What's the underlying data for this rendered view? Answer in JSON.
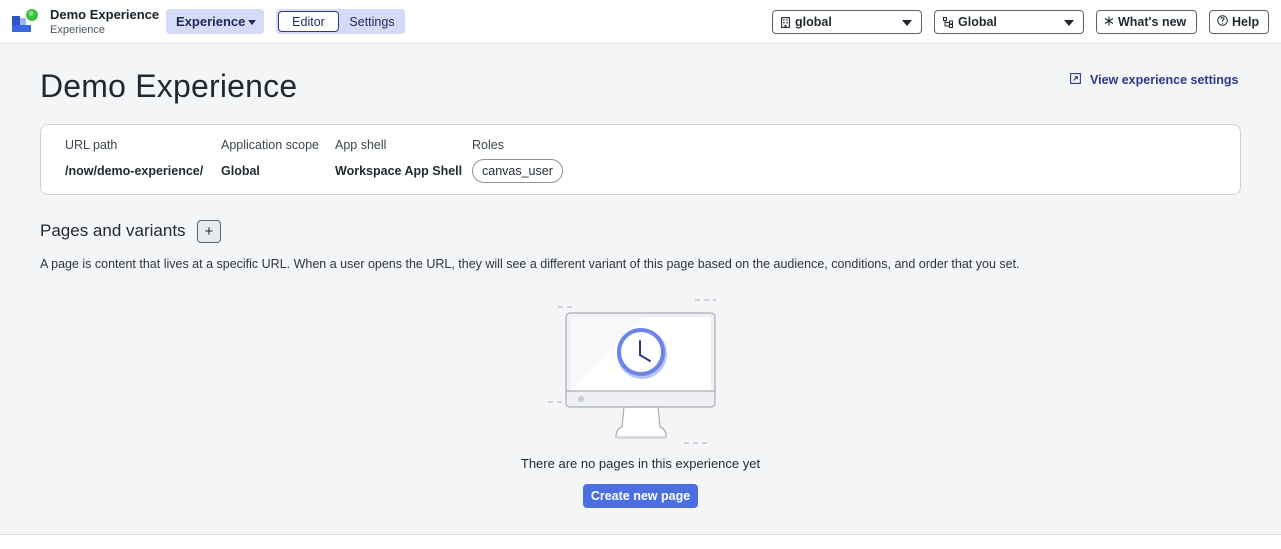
{
  "header": {
    "app_title": "Demo Experience",
    "app_subtitle": "Experience",
    "experience_menu_label": "Experience",
    "mode_tabs": [
      {
        "label": "Editor",
        "selected": true
      },
      {
        "label": "Settings",
        "selected": false
      }
    ],
    "scope_dropdown": {
      "value": "global",
      "icon": "building-icon"
    },
    "domain_dropdown": {
      "value": "Global",
      "icon": "hierarchy-icon"
    },
    "whats_new_label": "What's new",
    "help_label": "Help"
  },
  "main": {
    "title": "Demo Experience",
    "settings_link": "View experience settings",
    "details": {
      "url_path": {
        "label": "URL path",
        "value": "/now/demo-experience/"
      },
      "application_scope": {
        "label": "Application scope",
        "value": "Global"
      },
      "app_shell": {
        "label": "App shell",
        "value": "Workspace App Shell"
      },
      "roles": {
        "label": "Roles",
        "values": [
          "canvas_user"
        ]
      }
    },
    "pages_section": {
      "title": "Pages and variants",
      "add_symbol": "+",
      "description": "A page is content that lives at a specific URL. When a user opens the URL, they will see a different variant of this page based on the audience, conditions, and order that you set.",
      "empty_message": "There are no pages in this experience yet",
      "create_button": "Create new page"
    }
  },
  "colors": {
    "accent": "#4b6fe0",
    "link": "#2b3a8a",
    "chip_bg": "#d5dbf6",
    "page_bg": "#f4f5f7"
  }
}
